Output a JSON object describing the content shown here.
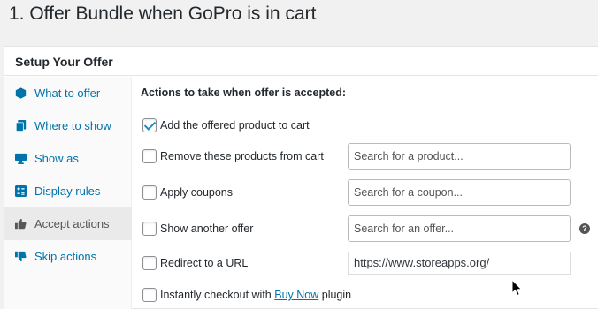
{
  "page": {
    "title": "1. Offer Bundle when GoPro is in cart"
  },
  "postbox": {
    "title": "Setup Your Offer"
  },
  "tabs": [
    {
      "label": "What to offer",
      "icon": "cube-icon"
    },
    {
      "label": "Where to show",
      "icon": "copy-icon"
    },
    {
      "label": "Show as",
      "icon": "desktop-icon"
    },
    {
      "label": "Display rules",
      "icon": "rules-icon"
    },
    {
      "label": "Accept actions",
      "icon": "thumbs-up-icon",
      "active": true
    },
    {
      "label": "Skip actions",
      "icon": "thumbs-down-icon"
    }
  ],
  "panel": {
    "heading": "Actions to take when offer is accepted:",
    "actions": [
      {
        "label": "Add the offered product to cart",
        "checked": true
      },
      {
        "label": "Remove these products from cart",
        "checked": false,
        "placeholder": "Search for a product..."
      },
      {
        "label": "Apply coupons",
        "checked": false,
        "placeholder": "Search for a coupon..."
      },
      {
        "label": "Show another offer",
        "checked": false,
        "placeholder": "Search for an offer...",
        "help": "?"
      },
      {
        "label": "Redirect to a URL",
        "checked": false,
        "value": "https://www.storeapps.org/"
      },
      {
        "label_prefix": "Instantly checkout with ",
        "link": "Buy Now",
        "label_suffix": " plugin",
        "checked": false
      }
    ]
  }
}
